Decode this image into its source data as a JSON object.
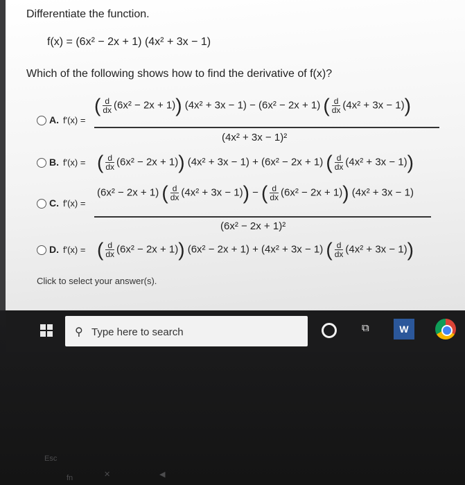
{
  "question": {
    "prompt": "Differentiate the function.",
    "given_lhs": "f(x) = ",
    "given_rhs": "(6x² − 2x + 1) (4x² + 3x − 1)",
    "ask": "Which of the following shows how to find the derivative of f(x)?"
  },
  "options": [
    {
      "letter": "A.",
      "fx": "f'(x) =",
      "numerator_a": "(6x² − 2x + 1)",
      "numerator_b": "(4x² + 3x − 1) − (6x² − 2x + 1)",
      "numerator_c": "(4x² + 3x − 1)",
      "denominator": "(4x² + 3x − 1)²"
    },
    {
      "letter": "B.",
      "fx": "f'(x) =",
      "part_a": "(6x² − 2x + 1)",
      "part_b": "(4x² + 3x − 1) + (6x² − 2x + 1)",
      "part_c": "(4x² + 3x − 1)"
    },
    {
      "letter": "C.",
      "fx": "f'(x) =",
      "numerator_a": "(6x² − 2x + 1)",
      "numerator_b": "(4x² + 3x − 1)",
      "numerator_c": "(6x² − 2x + 1)",
      "numerator_d": "(4x² + 3x − 1)",
      "denominator": "(6x² − 2x + 1)²"
    },
    {
      "letter": "D.",
      "fx": "f'(x) =",
      "part_a": "(6x² − 2x + 1)",
      "part_b": "(6x² − 2x + 1) + (4x² + 3x − 1)",
      "part_c": "(4x² + 3x − 1)"
    }
  ],
  "ddx": {
    "top": "d",
    "bottom": "dx"
  },
  "footer": "Click to select your answer(s).",
  "taskbar": {
    "search_placeholder": "Type here to search",
    "word_label": "W"
  },
  "keyboard": {
    "esc": "Esc",
    "fn_lock": "fn"
  }
}
